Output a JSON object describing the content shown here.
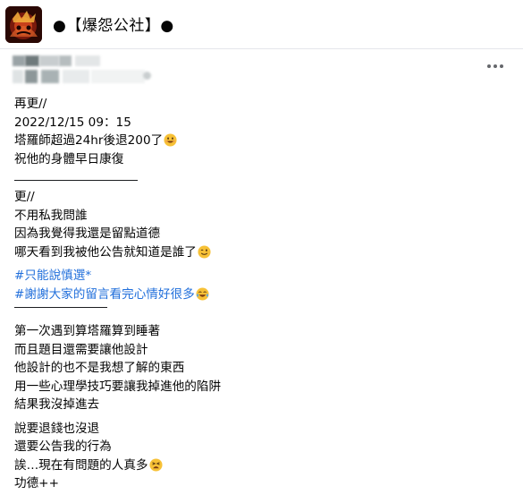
{
  "header": {
    "group_name": "●【爆怨公社】●"
  },
  "post": {
    "update2": "再更//",
    "update2_time": "2022/12/15 09：15",
    "update2_line1": "塔羅師超過24hr後退200了",
    "update2_line2": "祝他的身體早日康復",
    "update1": "更//",
    "update1_line1": "不用私我問誰",
    "update1_line2": "因為我覺得我還是留點道德",
    "update1_line3": "哪天看到我被他公告就知道是誰了",
    "hashtag1": "#只能說慎選*",
    "hashtag2": "#謝謝大家的留言看完心情好很多",
    "body_line1": "第一次遇到算塔羅算到睡著",
    "body_line2": "而且題目還需要讓他設計",
    "body_line3": "他設計的也不是我想了解的東西",
    "body_line4": "用一些心理學技巧要讓我掉進他的陷阱",
    "body_line5": "結果我沒掉進去",
    "body_line6": "說要退錢也沒退",
    "body_line7": "還要公告我的行為",
    "body_line8": "誒…現在有問題的人真多",
    "body_line9": "功德++"
  },
  "icons": {
    "smile_emoji": "smiling-face",
    "wink_emoji": "winking-face",
    "laugh_emoji": "tears-of-joy-face",
    "tired_emoji": "tired-face",
    "more": "more-dots-icon"
  },
  "colors": {
    "hashtag": "#216fdb",
    "text": "#050505",
    "emoji": "#f7c136"
  }
}
